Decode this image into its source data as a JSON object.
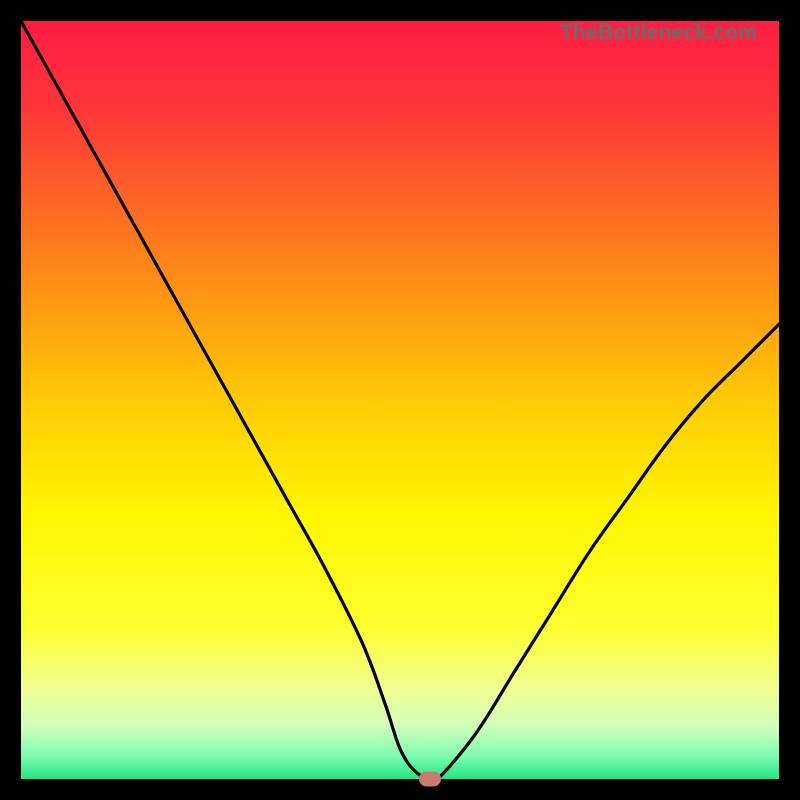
{
  "watermark": "TheBottleneck.com",
  "chart_data": {
    "type": "line",
    "title": "",
    "xlabel": "",
    "ylabel": "",
    "xlim": [
      0,
      100
    ],
    "ylim": [
      0,
      100
    ],
    "grid": false,
    "legend": false,
    "series": [
      {
        "name": "bottleneck-curve",
        "x": [
          0,
          5,
          10,
          15,
          20,
          25,
          30,
          35,
          40,
          45,
          48,
          50,
          52,
          54,
          55,
          60,
          65,
          70,
          75,
          80,
          85,
          90,
          95,
          100
        ],
        "y": [
          100,
          91,
          82,
          73,
          64,
          55,
          46,
          37,
          28,
          18,
          10,
          4,
          1,
          0,
          0,
          6,
          14,
          22,
          30,
          37,
          44,
          50,
          55,
          60
        ]
      }
    ],
    "marker": {
      "x": 54,
      "y": 0,
      "color": "#cb7a6f"
    },
    "background_gradient": {
      "stops": [
        {
          "offset": 0.0,
          "color": "#ff1d44"
        },
        {
          "offset": 0.12,
          "color": "#ff3739"
        },
        {
          "offset": 0.3,
          "color": "#ff7d1b"
        },
        {
          "offset": 0.5,
          "color": "#ffca06"
        },
        {
          "offset": 0.65,
          "color": "#fff600"
        },
        {
          "offset": 0.8,
          "color": "#fdff2f"
        },
        {
          "offset": 0.88,
          "color": "#f1ff91"
        },
        {
          "offset": 0.93,
          "color": "#d1ffba"
        },
        {
          "offset": 0.97,
          "color": "#7dfcb0"
        },
        {
          "offset": 1.0,
          "color": "#22e57e"
        }
      ]
    }
  }
}
